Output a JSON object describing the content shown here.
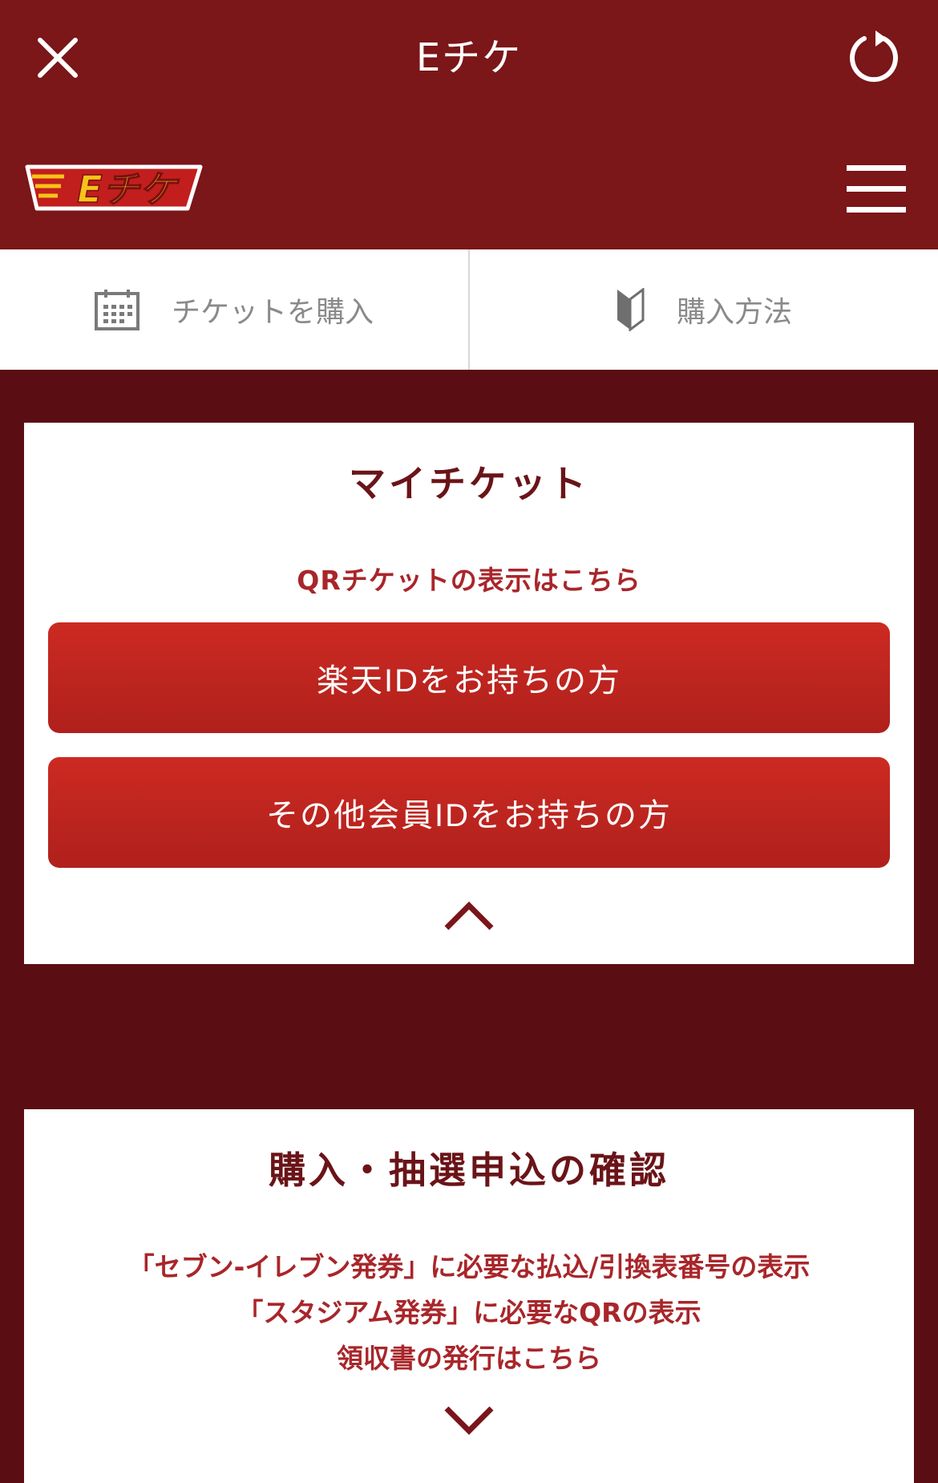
{
  "header": {
    "title": "Eチケ",
    "logo_text": "Eチケ"
  },
  "nav": {
    "buy_ticket": "チケットを購入",
    "how_to_buy": "購入方法"
  },
  "my_ticket": {
    "title": "マイチケット",
    "qr_link": "QRチケットの表示はこちら",
    "rakuten_button": "楽天IDをお持ちの方",
    "other_button": "その他会員IDをお持ちの方"
  },
  "confirm": {
    "title": "購入・抽選申込の確認",
    "line1": "「セブン-イレブン発券」に必要な払込/引換表番号の表示",
    "line2": "「スタジアム発券」に必要なQRの表示",
    "line3": "領収書の発行はこちら"
  },
  "colors": {
    "header_bg": "#7b1619",
    "page_bg": "#5a0e13",
    "button_red": "#c1251f",
    "title_text": "#6a1418",
    "link_text": "#a8262a"
  }
}
